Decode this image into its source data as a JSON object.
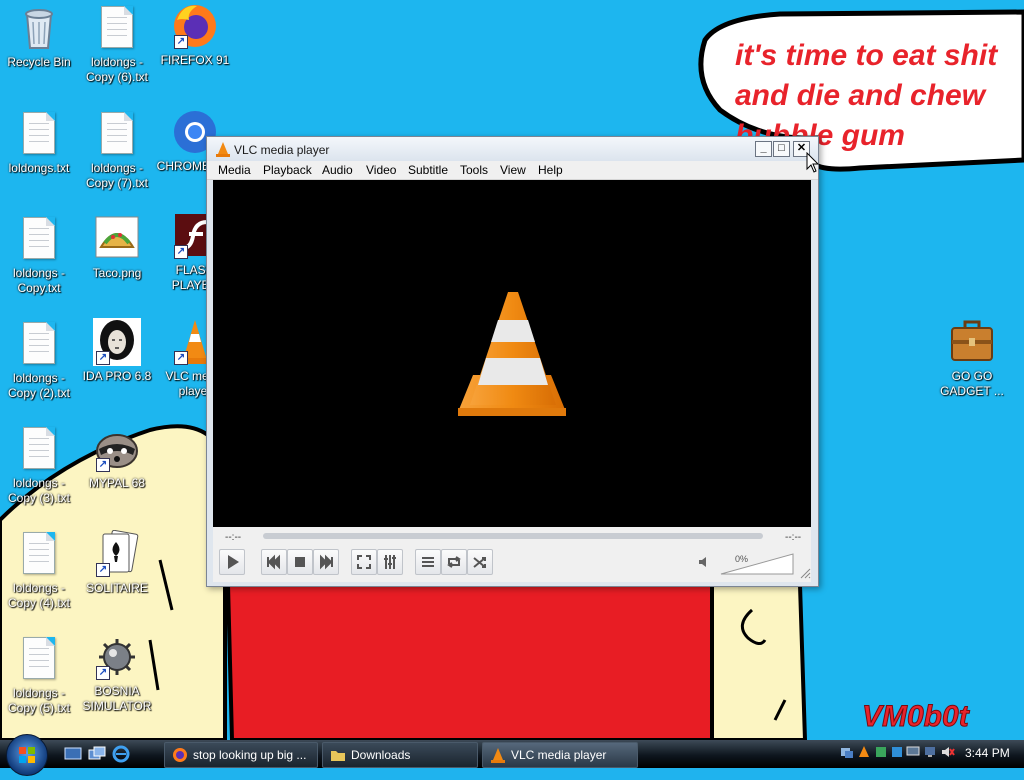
{
  "desktop": {
    "speech_bubble": [
      "it's time to eat shit",
      "and die and chew",
      "bubble gum"
    ],
    "signature": "VM0b0t",
    "icons": [
      {
        "label": "Recycle Bin",
        "icon": "recycle-bin-icon"
      },
      {
        "label": "loldongs - Copy (6).txt",
        "icon": "text-file-icon"
      },
      {
        "label": "FIREFOX 91",
        "icon": "firefox-icon"
      },
      {
        "label": "loldongs.txt",
        "icon": "text-file-icon"
      },
      {
        "label": "loldongs - Copy (7).txt",
        "icon": "text-file-icon"
      },
      {
        "label": "CHROME 101",
        "icon": "chrome-icon"
      },
      {
        "label": "loldongs - Copy.txt",
        "icon": "text-file-icon"
      },
      {
        "label": "Taco.png",
        "icon": "image-file-icon"
      },
      {
        "label": "FLASH PLAYER",
        "icon": "flash-player-icon"
      },
      {
        "label": "loldongs - Copy (2).txt",
        "icon": "text-file-icon"
      },
      {
        "label": "IDA PRO 6.8",
        "icon": "ida-pro-icon"
      },
      {
        "label": "VLC media player",
        "icon": "vlc-icon"
      },
      {
        "label": "loldongs - Copy (3).txt",
        "icon": "text-file-icon"
      },
      {
        "label": "MYPAL 68",
        "icon": "mypal-icon"
      },
      {
        "label": "loldongs - Copy (4).txt",
        "icon": "text-file-icon"
      },
      {
        "label": "SOLITAIRE",
        "icon": "solitaire-icon"
      },
      {
        "label": "loldongs - Copy (5).txt",
        "icon": "text-file-icon"
      },
      {
        "label": "BOSNIA SIMULATOR",
        "icon": "minesweeper-icon"
      },
      {
        "label": "GO GO GADGET ...",
        "icon": "briefcase-icon"
      }
    ]
  },
  "vlc": {
    "title": "VLC media player",
    "menu": [
      "Media",
      "Playback",
      "Audio",
      "Video",
      "Subtitle",
      "Tools",
      "View",
      "Help"
    ],
    "time_elapsed": "--:--",
    "time_total": "--:--",
    "volume": "0%",
    "volume_level": 0,
    "seek_progress": 0
  },
  "taskbar": {
    "tasks": [
      {
        "label": "stop looking up big ...",
        "icon": "firefox-icon",
        "active": false
      },
      {
        "label": "Downloads",
        "icon": "folder-icon",
        "active": false
      },
      {
        "label": "VLC media player",
        "icon": "vlc-icon",
        "active": true
      }
    ],
    "clock": "3:44 PM"
  },
  "colors": {
    "desktop": "#1db6ef",
    "vlc_orange": "#f28a13",
    "speech_text": "#e8232b"
  }
}
